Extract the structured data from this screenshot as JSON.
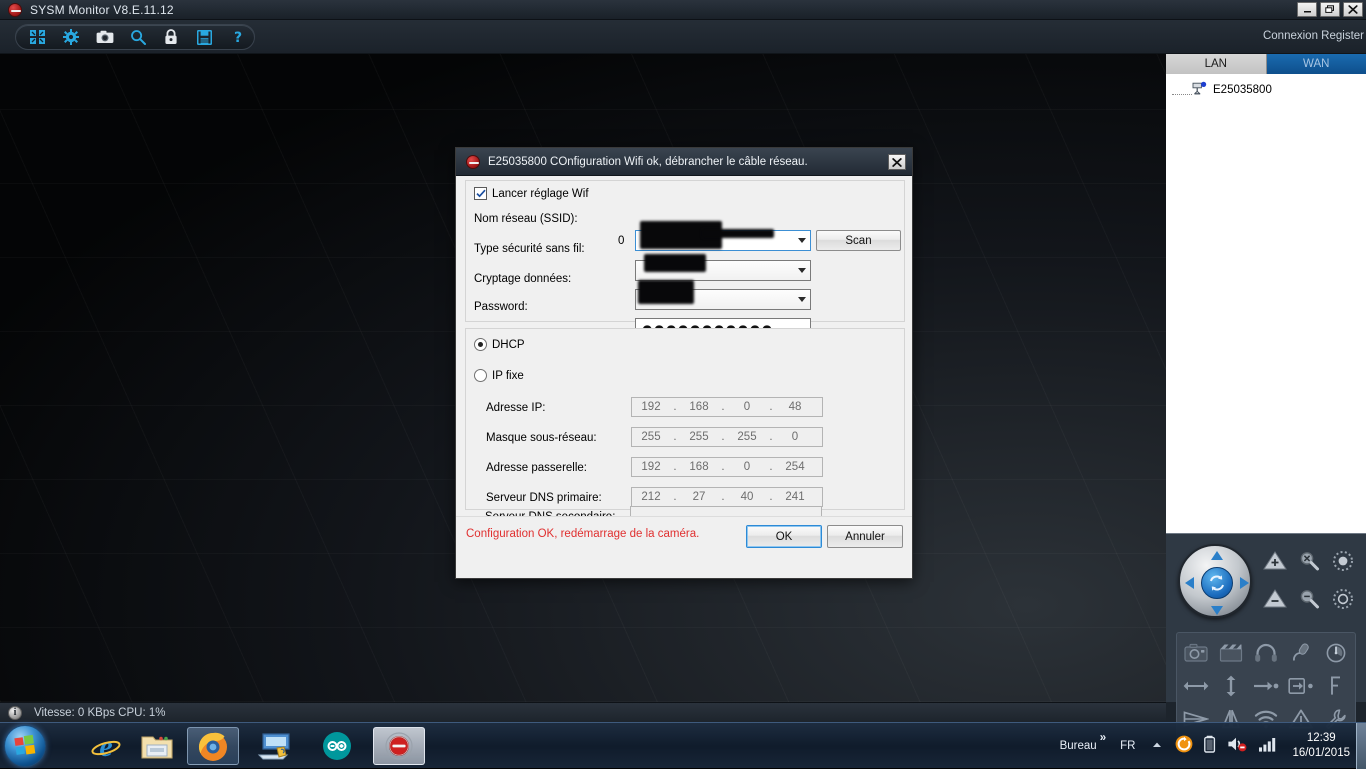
{
  "window": {
    "title": "SYSM Monitor  V8.E.11.12",
    "logo_icon": "sysm-logo-icon",
    "minimize_label": "_",
    "restore_label": "❐",
    "close_label": "✕"
  },
  "toolbar": {
    "buttons": [
      {
        "name": "layout-icon",
        "tooltip": "Layout"
      },
      {
        "name": "gear-icon",
        "tooltip": "Settings"
      },
      {
        "name": "camera-icon",
        "tooltip": "Snapshot"
      },
      {
        "name": "search-icon",
        "tooltip": "Search"
      },
      {
        "name": "lock-icon",
        "tooltip": "Lock"
      },
      {
        "name": "save-icon",
        "tooltip": "Save"
      },
      {
        "name": "help-icon",
        "tooltip": "Help",
        "glyph": "?"
      }
    ]
  },
  "header": {
    "connexion_register": "Connexion Register"
  },
  "right_panel": {
    "tabs": [
      {
        "label": "LAN",
        "active": true
      },
      {
        "label": "WAN",
        "active": false
      }
    ],
    "tree": [
      {
        "label": "E25035800",
        "icon": "camera-device-icon"
      }
    ],
    "ptz": {
      "up": "▲",
      "down": "▼",
      "left": "◀",
      "right": "▶",
      "center_icon": "ptz-refresh-icon",
      "controls": [
        {
          "name": "tilt-up-icon"
        },
        {
          "name": "zoom-in-icon"
        },
        {
          "name": "iris-open-icon"
        },
        {
          "name": "tilt-down-icon"
        },
        {
          "name": "zoom-out-icon"
        },
        {
          "name": "iris-close-icon"
        }
      ]
    },
    "functions": [
      {
        "name": "snapshot-icon"
      },
      {
        "name": "record-clip-icon"
      },
      {
        "name": "headphones-icon"
      },
      {
        "name": "microphone-icon"
      },
      {
        "name": "power-timer-icon"
      },
      {
        "name": "horizontal-scan-icon"
      },
      {
        "name": "vertical-scan-icon"
      },
      {
        "name": "goto-preset-icon"
      },
      {
        "name": "set-preset-icon"
      },
      {
        "name": "bracket-icon"
      },
      {
        "name": "flip-horizontal-icon"
      },
      {
        "name": "mirror-icon"
      },
      {
        "name": "wifi-icon"
      },
      {
        "name": "alarm-warning-icon"
      },
      {
        "name": "maintenance-wrench-icon"
      }
    ]
  },
  "statusbar": {
    "icon": "info-icon",
    "text": "Vitesse: 0 KBps  CPU:  1%"
  },
  "dialog": {
    "title": "E25035800  COnfiguration Wifi ok, débrancher le câble réseau.",
    "close_label": "✕",
    "wifi": {
      "enable_checkbox_label": "Lancer réglage Wif",
      "enable_checked": true,
      "ssid_label": "Nom réseau (SSID):",
      "ssid_count": "0",
      "ssid_value": "",
      "scan_button": "Scan",
      "security_label": "Type sécurité sans fil:",
      "security_value": "",
      "encryption_label": "Cryptage données:",
      "encryption_value": "",
      "password_label": "Password:",
      "password_value": "●●●●●●●●●●●"
    },
    "ip": {
      "dhcp_label": "DHCP",
      "dhcp_selected": true,
      "static_label": "IP fixe",
      "static_selected": false,
      "fields": [
        {
          "label": "Adresse IP:",
          "octets": [
            "192",
            "168",
            "0",
            "48"
          ]
        },
        {
          "label": "Masque sous-réseau:",
          "octets": [
            "255",
            "255",
            "255",
            "0"
          ]
        },
        {
          "label": "Adresse passerelle:",
          "octets": [
            "192",
            "168",
            "0",
            "254"
          ]
        },
        {
          "label": "Serveur DNS primaire:",
          "octets": [
            "212",
            "27",
            "40",
            "241"
          ]
        },
        {
          "label": "Serveur DNS secondaire:",
          "octets": [
            "",
            "",
            "",
            ""
          ]
        }
      ],
      "separator": "."
    },
    "footer": {
      "status_text": "Configuration OK, redémarrage de la caméra.",
      "ok_button": "OK",
      "cancel_button": "Annuler"
    }
  },
  "taskbar": {
    "start_icon": "windows-start-icon",
    "items": [
      {
        "name": "internet-explorer-icon",
        "state": "pinned"
      },
      {
        "name": "file-explorer-icon",
        "state": "pinned"
      },
      {
        "name": "firefox-icon",
        "state": "active"
      },
      {
        "name": "remote-desktop-icon",
        "state": "pinned"
      },
      {
        "name": "arduino-icon",
        "state": "pinned"
      },
      {
        "name": "sysm-monitor-icon",
        "state": "running"
      }
    ],
    "tray": {
      "desktop_label": "Bureau",
      "overflow_label": "»",
      "language": "FR",
      "expand_icon": "chevron-up-icon",
      "icons": [
        "update-icon",
        "battery-icon",
        "volume-muted-icon",
        "network-signal-icon"
      ],
      "time": "12:39",
      "date": "16/01/2015"
    }
  },
  "colors": {
    "accent_blue": "#1a6bb0",
    "app_chrome": "#1d242c",
    "status_red": "#e03030",
    "dialog_bg": "#f0f0f0"
  }
}
